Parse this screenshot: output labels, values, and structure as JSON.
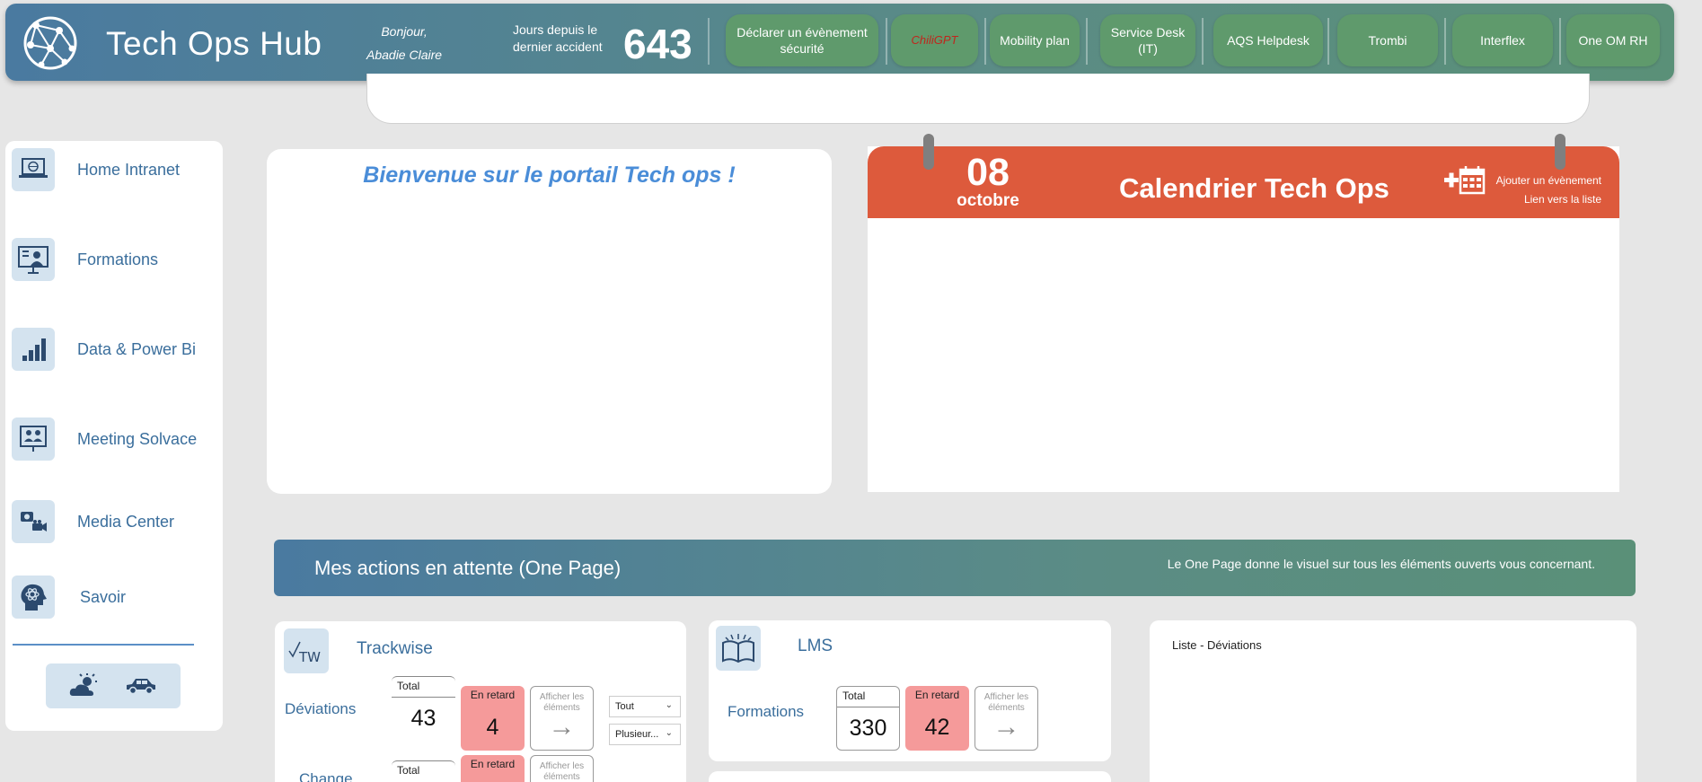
{
  "header": {
    "title": "Tech Ops Hub",
    "greeting": "Bonjour,",
    "user": "Abadie Claire",
    "accident_label_1": "Jours depuis le",
    "accident_label_2": "dernier accident",
    "accident_days": "643",
    "buttons": [
      {
        "label": "Déclarer un évènement sécurité"
      },
      {
        "label": "ChiliGPT"
      },
      {
        "label": "Mobility plan"
      },
      {
        "label": "Service Desk (IT)"
      },
      {
        "label": "AQS Helpdesk"
      },
      {
        "label": "Trombi"
      },
      {
        "label": "Interflex"
      },
      {
        "label": "One OM RH"
      }
    ]
  },
  "sidebar": {
    "items": [
      {
        "label": "Home Intranet",
        "icon": "laptop-globe-icon"
      },
      {
        "label": "Formations",
        "icon": "presentation-icon"
      },
      {
        "label": "Data & Power Bi",
        "icon": "bar-chart-icon"
      },
      {
        "label": "Meeting Solvace",
        "icon": "meeting-board-icon"
      },
      {
        "label": "Media Center",
        "icon": "camera-icon"
      },
      {
        "label": "Savoir",
        "icon": "head-atom-icon"
      }
    ],
    "tools": [
      "weather-icon",
      "car-icon"
    ]
  },
  "welcome": {
    "text": "Bienvenue sur le portail Tech ops !"
  },
  "calendar": {
    "day": "08",
    "month": "octobre",
    "title": "Calendrier Tech Ops",
    "add_event": "Ajouter un évènement",
    "list_link": "Lien vers la liste"
  },
  "actions": {
    "title": "Mes actions en attente (One Page)",
    "note": "Le One Page donne le visuel sur tous les éléments ouverts vous concernant."
  },
  "trackwise": {
    "title": "Trackwise",
    "icon_text": "TW",
    "rows": [
      {
        "label": "Déviations",
        "total_label": "Total",
        "total": "43",
        "late_label": "En retard",
        "late": "4",
        "show_label": "Afficher les éléments"
      },
      {
        "label": "Change",
        "total_label": "Total",
        "late_label": "En retard",
        "show_label": "Afficher les éléments"
      }
    ],
    "filter_1": "Tout",
    "filter_2": "Plusieur..."
  },
  "lms": {
    "title": "LMS",
    "row_label": "Formations",
    "total_label": "Total",
    "total": "330",
    "late_label": "En retard",
    "late": "42",
    "show_label": "Afficher les éléments"
  },
  "list": {
    "title": "Liste - Déviations"
  }
}
